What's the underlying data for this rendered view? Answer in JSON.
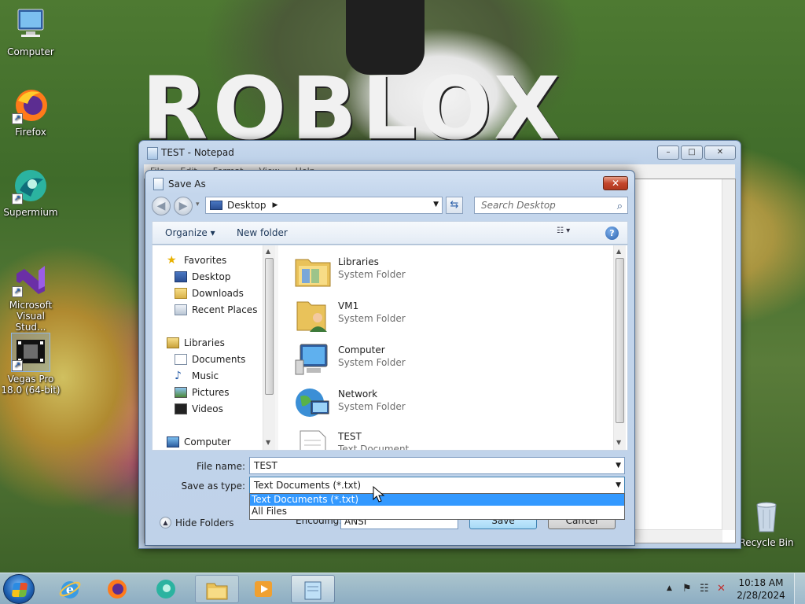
{
  "desktop": {
    "icons": [
      {
        "label": "Computer",
        "icon": "computer-icon"
      },
      {
        "label": "Firefox",
        "icon": "firefox-icon"
      },
      {
        "label": "Supermium",
        "icon": "supermium-icon"
      },
      {
        "label": "Microsoft Visual Stud...",
        "icon": "visual-studio-icon"
      },
      {
        "label": "Vegas Pro 18.0 (64-bit)",
        "icon": "vegas-pro-icon"
      },
      {
        "label": "Recycle Bin",
        "icon": "recycle-bin-icon"
      }
    ]
  },
  "notepad": {
    "title": "TEST - Notepad",
    "menu": [
      "File",
      "Edit",
      "Format",
      "View",
      "Help"
    ],
    "min": "–",
    "max": "□",
    "close": "✕"
  },
  "dialog": {
    "title": "Save As",
    "close": "✕",
    "back": "◀",
    "forward": "▶",
    "history": "▾",
    "breadcrumb": "Desktop",
    "breadcrumb_sep": "▶",
    "address_drop": "▼",
    "refresh": "⇆",
    "search_placeholder": "Search Desktop",
    "search_icon": "⌕",
    "toolbar": {
      "organize": "Organize ▾",
      "new_folder": "New folder",
      "views": "☷  ▾",
      "help": "?"
    },
    "nav": {
      "favorites": "Favorites",
      "desktop": "Desktop",
      "downloads": "Downloads",
      "recent": "Recent Places",
      "libraries": "Libraries",
      "documents": "Documents",
      "music": "Music",
      "pictures": "Pictures",
      "videos": "Videos",
      "computer": "Computer",
      "scroll_up": "▲",
      "scroll_down": "▼"
    },
    "files": [
      {
        "name": "Libraries",
        "type": "System Folder"
      },
      {
        "name": "VM1",
        "type": "System Folder"
      },
      {
        "name": "Computer",
        "type": "System Folder"
      },
      {
        "name": "Network",
        "type": "System Folder"
      },
      {
        "name": "TEST",
        "type": "Text Document"
      }
    ],
    "file_name_label": "File name:",
    "file_name_value": "TEST",
    "save_type_label": "Save as type:",
    "save_type_value": "Text Documents (*.txt)",
    "combo_arrow": "▼",
    "type_options": [
      "Text Documents (*.txt)",
      "All Files"
    ],
    "hide_folders": "Hide Folders",
    "hide_folders_icon": "▲",
    "encoding_label": "Encoding:",
    "encoding_value": "ANSI",
    "save": "Save",
    "cancel": "Cancel"
  },
  "taskbar": {
    "apps": [
      "internet-explorer-icon",
      "firefox-icon",
      "supermium-icon",
      "file-explorer-icon",
      "media-player-icon",
      "notepad-icon"
    ],
    "tray_up": "▲",
    "flag": "⚑",
    "network": "☷",
    "volume": "✕",
    "time": "10:18 AM",
    "date": "2/28/2024"
  }
}
